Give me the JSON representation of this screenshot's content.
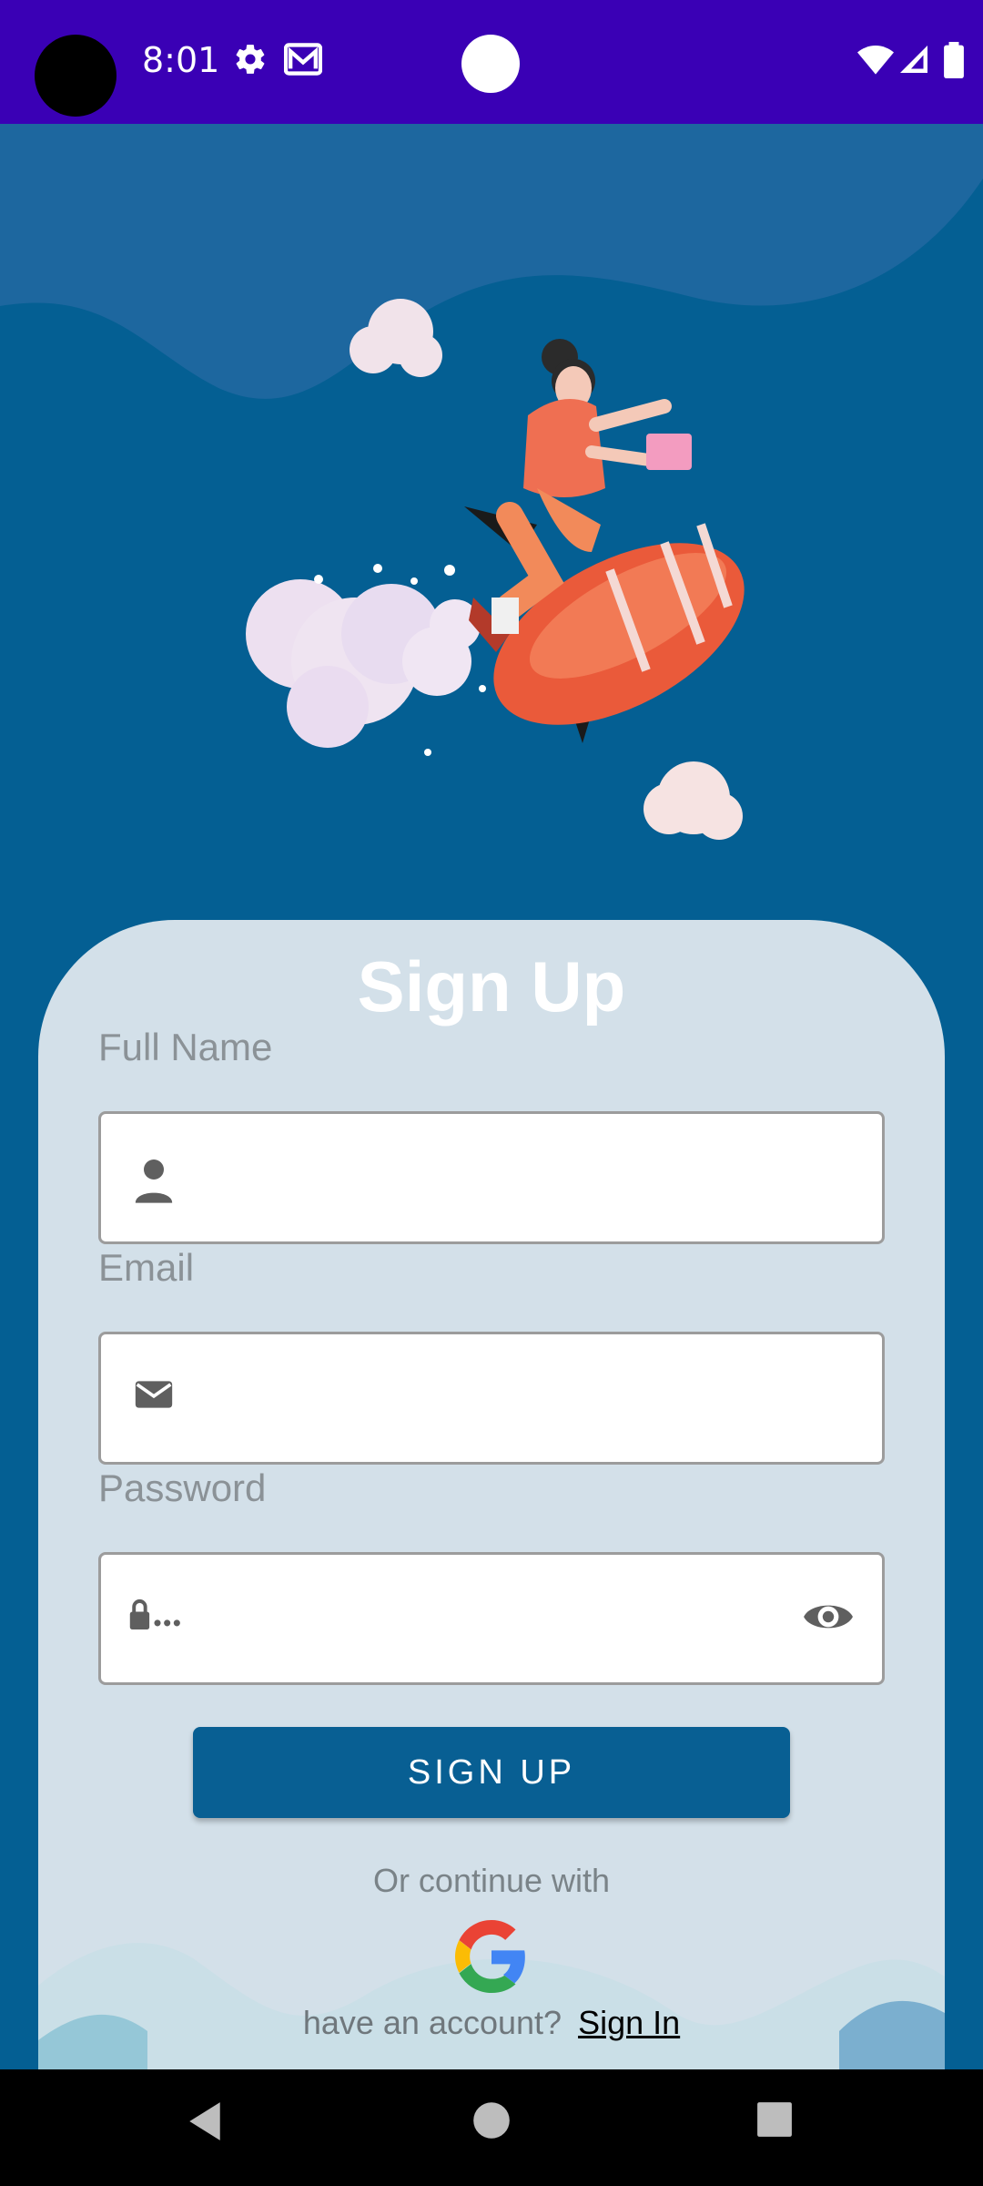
{
  "status_bar": {
    "time": "8:01",
    "icons_left": [
      "settings-icon",
      "mail-icon"
    ],
    "icons_right": [
      "wifi-icon",
      "signal-icon",
      "battery-icon"
    ]
  },
  "colors": {
    "status_bar": "#3a00b5",
    "background": "#045f93",
    "card": "#d3e0e9",
    "button": "#085f93"
  },
  "card": {
    "title": "Sign Up",
    "fields": [
      {
        "label": "Full Name",
        "value": "",
        "icon": "person-icon"
      },
      {
        "label": "Email",
        "value": "",
        "icon": "email-icon"
      },
      {
        "label": "Password",
        "value": "",
        "icon": "password-icon",
        "trailing_icon": "eye-icon"
      }
    ],
    "signup_label": "SIGN UP",
    "or_text": "Or continue with",
    "google_icon": "google-icon",
    "account_prompt": "have an account?",
    "signin_label": "Sign In"
  },
  "nav_bar": {
    "buttons": [
      "back-icon",
      "home-icon",
      "recents-icon"
    ]
  }
}
